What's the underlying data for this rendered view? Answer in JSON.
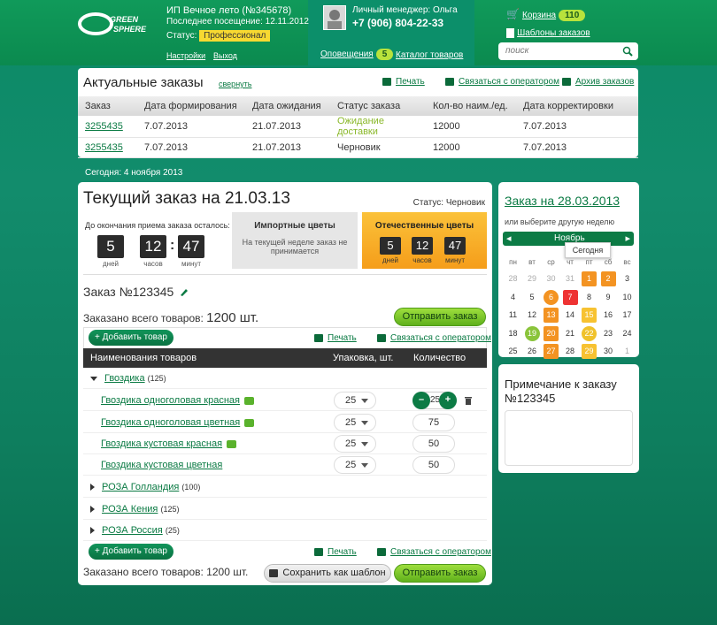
{
  "header": {
    "company": "ИП Вечное лето (№345678)",
    "last_visit": "Последнее посещение: 12.11.2012",
    "status_label": "Статус:",
    "status_value": "Профессионал",
    "settings": "Настройки",
    "logout": "Выход",
    "manager_label": "Личный менеджер: Ольга",
    "manager_phone": "+7 (906) 804-22-33",
    "notifications": "Оповещения",
    "notifications_count": "5",
    "catalog": "Каталог товаров",
    "cart": "Корзина",
    "cart_count": "110",
    "templates": "Шаблоны заказов",
    "search_placeholder": "поиск",
    "logo_line1": "GREEN",
    "logo_line2": "SPHERE"
  },
  "orders": {
    "title": "Актуальные заказы",
    "collapse": "свернуть",
    "print": "Печать",
    "contact": "Связаться с оператором",
    "archive": "Архив заказов",
    "columns": [
      "Заказ",
      "Дата формирования",
      "Дата ожидания",
      "Статус заказа",
      "Кол-во наим./ед.",
      "Дата корректировки"
    ],
    "rows": [
      [
        "3255435",
        "7.07.2013",
        "21.07.2013",
        "Ожидание доставки",
        "12000",
        "7.07.2013"
      ],
      [
        "3255435",
        "7.07.2013",
        "21.07.2013",
        "Черновик",
        "12000",
        "7.07.2013"
      ]
    ]
  },
  "today": "Сегодня: 4 ноября 2013",
  "current": {
    "title": "Текущий заказ на 21.03.13",
    "status": "Статус: Черновик",
    "deadline_label": "До окончания приема заказа осталось:",
    "days": "5",
    "hours": "12",
    "minutes": "47",
    "days_lbl": "дней",
    "hours_lbl": "часов",
    "minutes_lbl": "минут",
    "import_title": "Импортные цветы",
    "import_text": "На текущей неделе заказ не принимается",
    "domestic_title": "Отечественные цветы",
    "order_no": "Заказ №123345",
    "total_label": "Заказано всего товаров:",
    "total_value": "1200 шт.",
    "send": "Отправить заказ",
    "add": "Добавить товар",
    "print": "Печать",
    "contact": "Связаться с оператором",
    "col_name": "Наименования товаров",
    "col_pack": "Упаковка, шт.",
    "col_qty": "Количество",
    "save_template": "Сохранить как шаблон",
    "groups": [
      {
        "name": "Гвоздика",
        "count": "(125)"
      },
      {
        "name": "РОЗА Голландия",
        "count": "(100)"
      },
      {
        "name": "РОЗА Кения",
        "count": "(125)"
      },
      {
        "name": "РОЗА Россия",
        "count": "(25)"
      }
    ],
    "items": [
      {
        "name": "Гвоздика одноголовая красная",
        "pack": "25",
        "qty": "25"
      },
      {
        "name": "Гвоздика одноголовая цветная",
        "pack": "25",
        "qty": "75"
      },
      {
        "name": "Гвоздика кустовая красная",
        "pack": "25",
        "qty": "50"
      },
      {
        "name": "Гвоздика кустовая цветная",
        "pack": "25",
        "qty": "50"
      }
    ]
  },
  "calendar": {
    "title": "Заказ на 28.03.2013",
    "subtitle": "или выберите другую неделю",
    "month": "Ноябрь",
    "tooltip": "Сегодня",
    "weekdays": [
      "пн",
      "вт",
      "ср",
      "чт",
      "пт",
      "сб",
      "вс"
    ],
    "weeks": [
      [
        "28",
        "29",
        "30",
        "31",
        "1",
        "2",
        "3"
      ],
      [
        "4",
        "5",
        "6",
        "7",
        "8",
        "9",
        "10"
      ],
      [
        "11",
        "12",
        "13",
        "14",
        "15",
        "16",
        "17"
      ],
      [
        "18",
        "19",
        "20",
        "21",
        "22",
        "23",
        "24"
      ],
      [
        "25",
        "26",
        "27",
        "28",
        "29",
        "30",
        "1"
      ]
    ]
  },
  "note": {
    "title": "Примечание к заказу №123345"
  }
}
